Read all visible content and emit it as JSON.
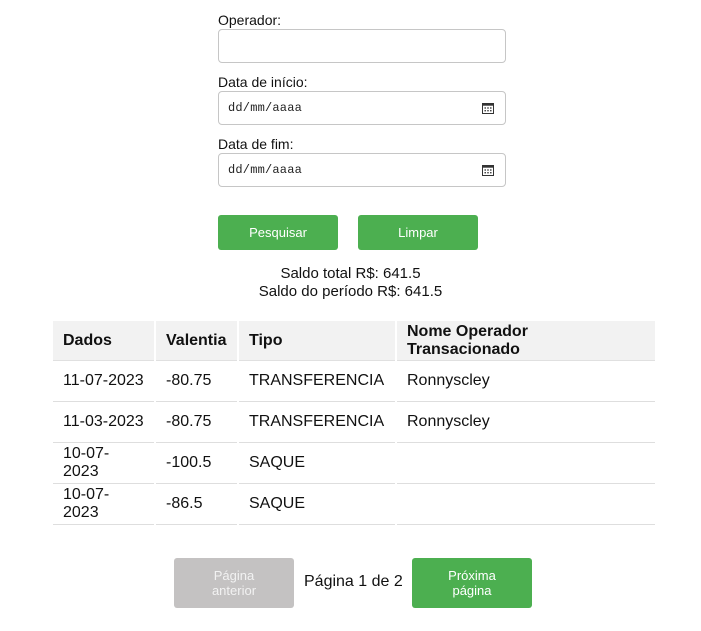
{
  "form": {
    "operator_label": "Operador:",
    "operator_value": "",
    "start_label": "Data de início:",
    "start_value": "dd/mm/aaaa",
    "end_label": "Data de fim:",
    "end_value": "dd/mm/aaaa",
    "calendar_icon": "calendar-icon"
  },
  "buttons": {
    "search": "Pesquisar",
    "clear": "Limpar"
  },
  "summary": {
    "total": "Saldo total R$: 641.5",
    "period": "Saldo do período R$: 641.5"
  },
  "table": {
    "headers": [
      "Dados",
      "Valentia",
      "Tipo",
      "Nome Operador Transacionado"
    ],
    "rows": [
      [
        "11-07-2023",
        "-80.75",
        "TRANSFERENCIA",
        "Ronnyscley"
      ],
      [
        "11-03-2023",
        "-80.75",
        "TRANSFERENCIA",
        "Ronnyscley"
      ],
      [
        "10-07-2023",
        "-100.5",
        "SAQUE",
        ""
      ],
      [
        "10-07-2023",
        "-86.5",
        "SAQUE",
        ""
      ]
    ]
  },
  "pagination": {
    "prev_line1": "Página",
    "prev_line2": "anterior",
    "status": "Página 1 de 2",
    "next_line1": "Próxima",
    "next_line2": "página"
  },
  "colors": {
    "primary": "#4caf50",
    "disabled": "#c4c2c2",
    "header_bg": "#f2f2f2"
  }
}
